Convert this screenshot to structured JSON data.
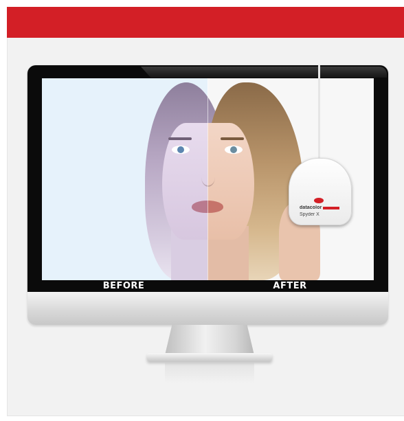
{
  "header": {
    "bar_color": "#d31f26"
  },
  "monitor": {
    "labels": {
      "before": "BEFORE",
      "after": "AFTER"
    }
  },
  "device": {
    "brand": "datacolor",
    "model": "Spyder X",
    "brand_color": "#d31f26"
  }
}
